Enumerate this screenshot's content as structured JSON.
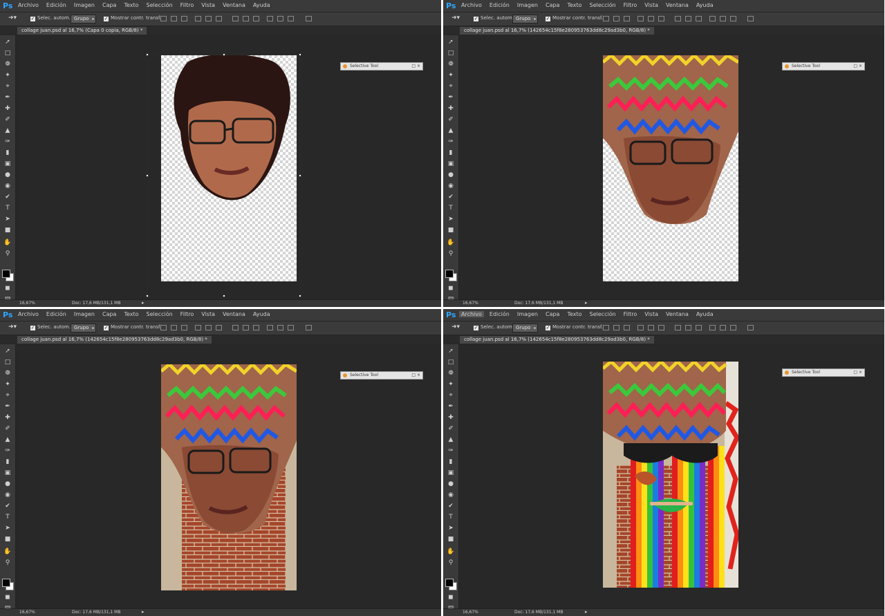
{
  "menu": [
    "Archivo",
    "Edición",
    "Imagen",
    "Capa",
    "Texto",
    "Selección",
    "Filtro",
    "Vista",
    "Ventana",
    "Ayuda"
  ],
  "logo": "Ps",
  "options": {
    "auto_select": "Selec. autom.:",
    "group": "Grupo",
    "show_transform": "Mostrar contr. transf."
  },
  "panes": {
    "tl": {
      "doc_tab": "collage juan.psd al 16,7% (Capa 0 copia, RGB/8) *",
      "zoom": "16,67%",
      "doc": "Doc: 17,6 MB/131,1 MB"
    },
    "tr": {
      "doc_tab": "collage juan.psd al 16,7% (142654c15f8e280953763dd8c29ad3b0, RGB/8) *",
      "zoom": "16,67%",
      "doc": "Doc: 17,6 MB/131,1 MB"
    },
    "bl": {
      "doc_tab": "collage juan.psd al 16,7% (142654c15f8e280953763dd8c29ad3b0, RGB/8) *",
      "zoom": "16,67%",
      "doc": "Doc: 17,6 MB/131,1 MB"
    },
    "br": {
      "doc_tab": "collage juan.psd al 16,7% (142654c15f8e280953763dd8c29ad3b0, RGB/8) *",
      "zoom": "16,67%",
      "doc": "Doc: 17,6 MB/131,1 MB"
    }
  },
  "floating_panel": {
    "title": "Selective Tool",
    "buttons": "□ ×"
  },
  "colors": {
    "workspace": "#282828",
    "menubar": "#3a3a3a",
    "ps_blue": "#2fa6ff"
  }
}
